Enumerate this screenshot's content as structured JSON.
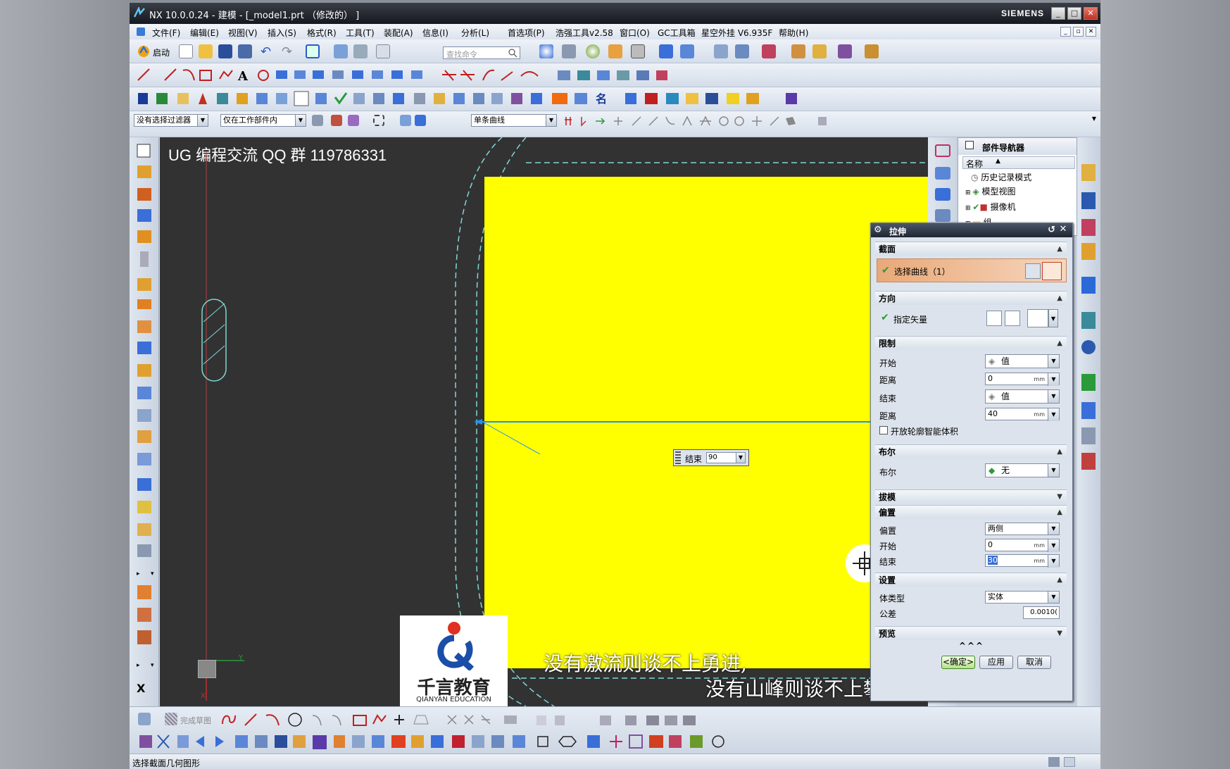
{
  "window": {
    "title": "NX 10.0.0.24 - 建模 - [_model1.prt （修改的） ]",
    "brand": "SIEMENS",
    "minimize": "_",
    "maximize": "□",
    "close": "✕"
  },
  "menubar": {
    "items": [
      "文件(F)",
      "编辑(E)",
      "视图(V)",
      "插入(S)",
      "格式(R)",
      "工具(T)",
      "装配(A)",
      "信息(I)",
      "分析(L)",
      "首选项(P)",
      "浩强工具v2.58",
      "窗口(O)",
      "GC工具箱",
      "星空外挂 V6.935F",
      "帮助(H)"
    ],
    "right_min": "_",
    "right_max": "▫",
    "right_close": "✕"
  },
  "toolbar1": {
    "start_label": "启动",
    "search_placeholder": "查找命令"
  },
  "selectionbar": {
    "filter": "没有选择过滤器",
    "scope": "仅在工作部件内",
    "curve_rule": "单条曲线"
  },
  "viewport": {
    "watermark": "UG 编程交流 QQ 群 119786331",
    "end_label": "结束",
    "end_value": "90",
    "subtitle_line1": "没有激流则谈不上勇进,",
    "subtitle_line2": "没有山峰则谈不上攀登。",
    "logo_text": "千言教育",
    "logo_sub": "QIANYAN EDUCATION",
    "axis_x": "X",
    "axis_y": "Y"
  },
  "part_navigator": {
    "title": "部件导航器",
    "column": "名称",
    "items": [
      "历史记录模式",
      "模型视图",
      "摄像机",
      "组"
    ]
  },
  "extrude_dialog": {
    "title": "拉伸",
    "section": {
      "label": "截面",
      "select_curve": "选择曲线（1）"
    },
    "direction": {
      "label": "方向",
      "specify_vector": "指定矢量"
    },
    "limits": {
      "label": "限制",
      "start_label": "开始",
      "start_option": "值",
      "start_dist_label": "距离",
      "start_dist": "0",
      "end_label": "结束",
      "end_option": "值",
      "end_dist_label": "距离",
      "end_dist": "40",
      "open_profile": "开放轮廓智能体积"
    },
    "boolean": {
      "label": "布尔",
      "field_label": "布尔",
      "value": "无"
    },
    "draft": {
      "label": "拔模"
    },
    "offset": {
      "label": "偏置",
      "field_label": "偏置",
      "value": "两侧",
      "start_label": "开始",
      "start": "0",
      "end_label": "结束",
      "end": "30"
    },
    "settings": {
      "label": "设置",
      "body_type_label": "体类型",
      "body_type": "实体",
      "tolerance_label": "公差",
      "tolerance": "0.0010("
    },
    "preview": {
      "label": "预览"
    },
    "more": "^^^",
    "unit": "mm",
    "ok": "<确定>",
    "apply": "应用",
    "cancel": "取消"
  },
  "bottombar": {
    "finish_sketch": "完成草图"
  },
  "status": {
    "message": "选择截面几何图形"
  },
  "colors": {
    "viewport": "#323232",
    "solid_face": "#ffff00",
    "edge_line": "#1e90ff",
    "curve": "#7fd6d6"
  }
}
